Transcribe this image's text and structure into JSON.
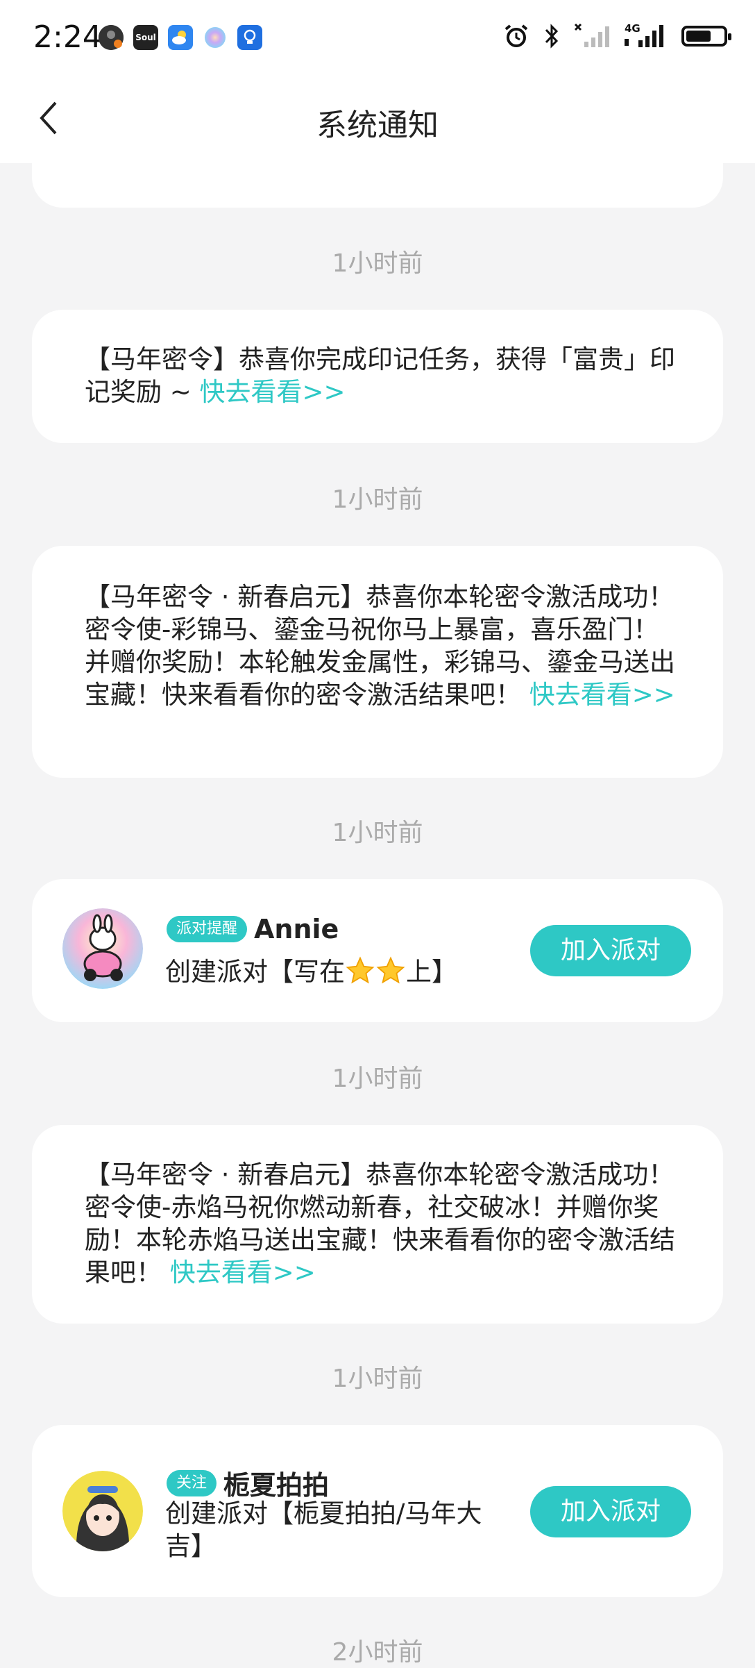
{
  "status_bar": {
    "time": "2:24",
    "app_icons": [
      "account-avatar-icon",
      "soul-app-icon",
      "weather-icon",
      "assistant-orb-icon",
      "bulb-app-icon"
    ],
    "soul_label": "Soul",
    "network": "4G"
  },
  "header": {
    "title": "系统通知"
  },
  "colors": {
    "accent": "#2ec8c5",
    "background": "#f4f4f5"
  },
  "notifications": [
    {
      "type": "text",
      "text": "【马年密令】恭喜你完成印记任务，获得「富贵」印记奖励 ~ ",
      "link": "快去看看>>",
      "timestamp": "1小时前"
    },
    {
      "type": "text",
      "text": "【马年密令 · 新春启元】恭喜你本轮密令激活成功！密令使-彩锦马、鎏金马祝你马上暴富，喜乐盈门！并赠你奖励！本轮触发金属性，彩锦马、鎏金马送出宝藏！快来看看你的密令激活结果吧！ ",
      "link": "快去看看>>",
      "timestamp": "1小时前"
    },
    {
      "type": "party",
      "tag": "派对提醒",
      "name": "Annie",
      "desc_prefix": "创建派对【写在",
      "desc_suffix": "上】",
      "button": "加入派对",
      "timestamp": "1小时前"
    },
    {
      "type": "text",
      "text": "【马年密令 · 新春启元】恭喜你本轮密令激活成功！密令使-赤焰马祝你燃动新春，社交破冰！并赠你奖励！本轮赤焰马送出宝藏！快来看看你的密令激活结果吧！ ",
      "link": "快去看看>>",
      "timestamp": "1小时前"
    },
    {
      "type": "party",
      "tag": "关注",
      "name": "栀夏拍拍",
      "desc": "创建派对【栀夏拍拍/马年大吉】",
      "button": "加入派对",
      "timestamp": "1小时前"
    }
  ],
  "trailing_timestamp": "2小时前"
}
